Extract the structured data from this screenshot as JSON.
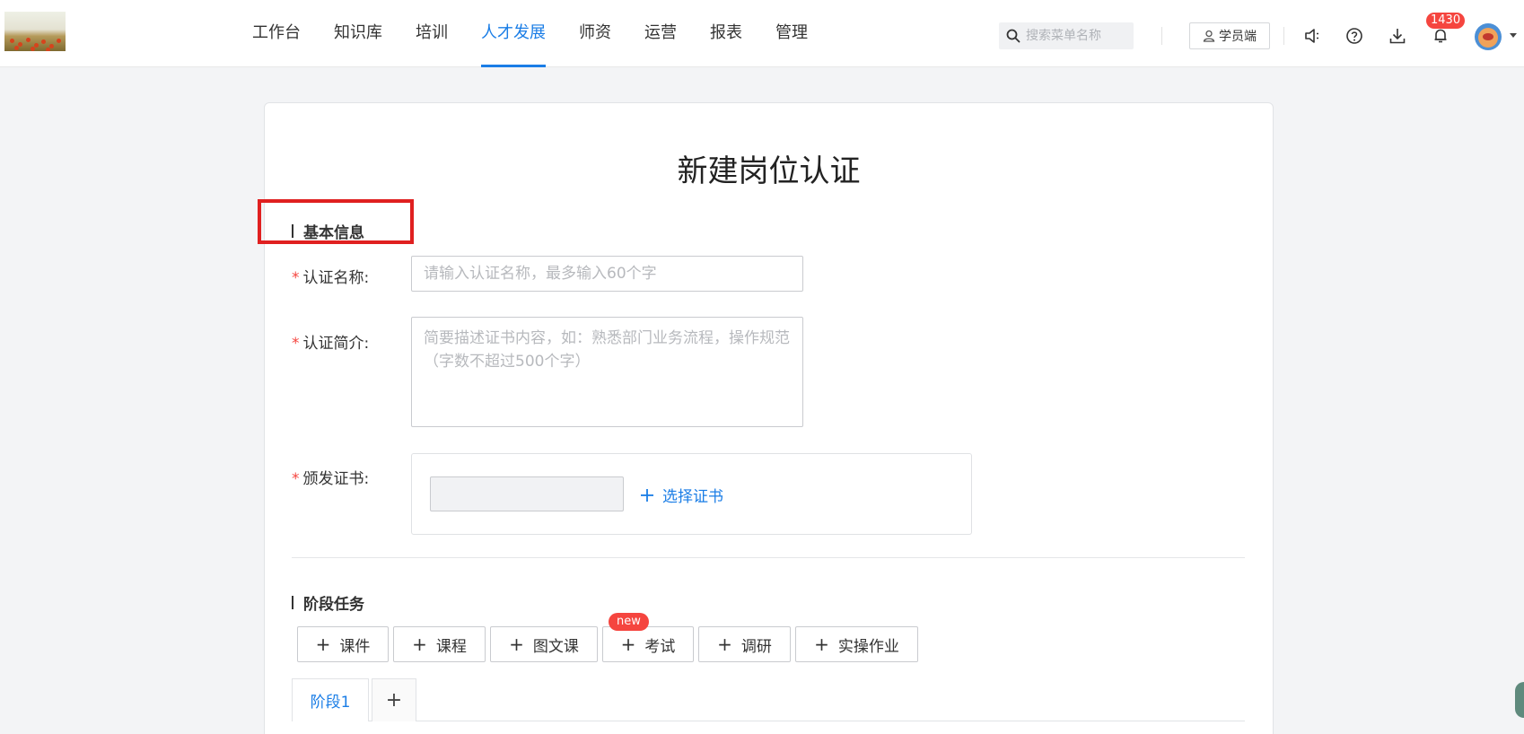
{
  "nav": {
    "items": [
      {
        "label": "工作台",
        "active": false
      },
      {
        "label": "知识库",
        "active": false
      },
      {
        "label": "培训",
        "active": false
      },
      {
        "label": "人才发展",
        "active": true
      },
      {
        "label": "师资",
        "active": false
      },
      {
        "label": "运营",
        "active": false
      },
      {
        "label": "报表",
        "active": false
      },
      {
        "label": "管理",
        "active": false
      }
    ]
  },
  "header": {
    "search_placeholder": "搜索菜单名称",
    "student_button": "学员端",
    "notification_count": "1430",
    "accent_color": "#1a7de6"
  },
  "form": {
    "page_title": "新建岗位认证",
    "basic_section": "基本信息",
    "name_label": "认证名称:",
    "name_placeholder": "请输入认证名称，最多输入60个字",
    "intro_label": "认证简介:",
    "intro_placeholder": "简要描述证书内容，如：熟悉部门业务流程，操作规范（字数不超过500个字）",
    "cert_label": "颁发证书:",
    "cert_select": "选择证书",
    "required_mark": "*"
  },
  "stage": {
    "section_title": "阶段任务",
    "buttons": [
      {
        "label": "课件"
      },
      {
        "label": "课程"
      },
      {
        "label": "图文课"
      },
      {
        "label": "考试",
        "tag": "new"
      },
      {
        "label": "调研"
      },
      {
        "label": "实操作业"
      }
    ],
    "tabs": [
      {
        "label": "阶段1",
        "active": true
      }
    ],
    "add_tab": "+"
  }
}
